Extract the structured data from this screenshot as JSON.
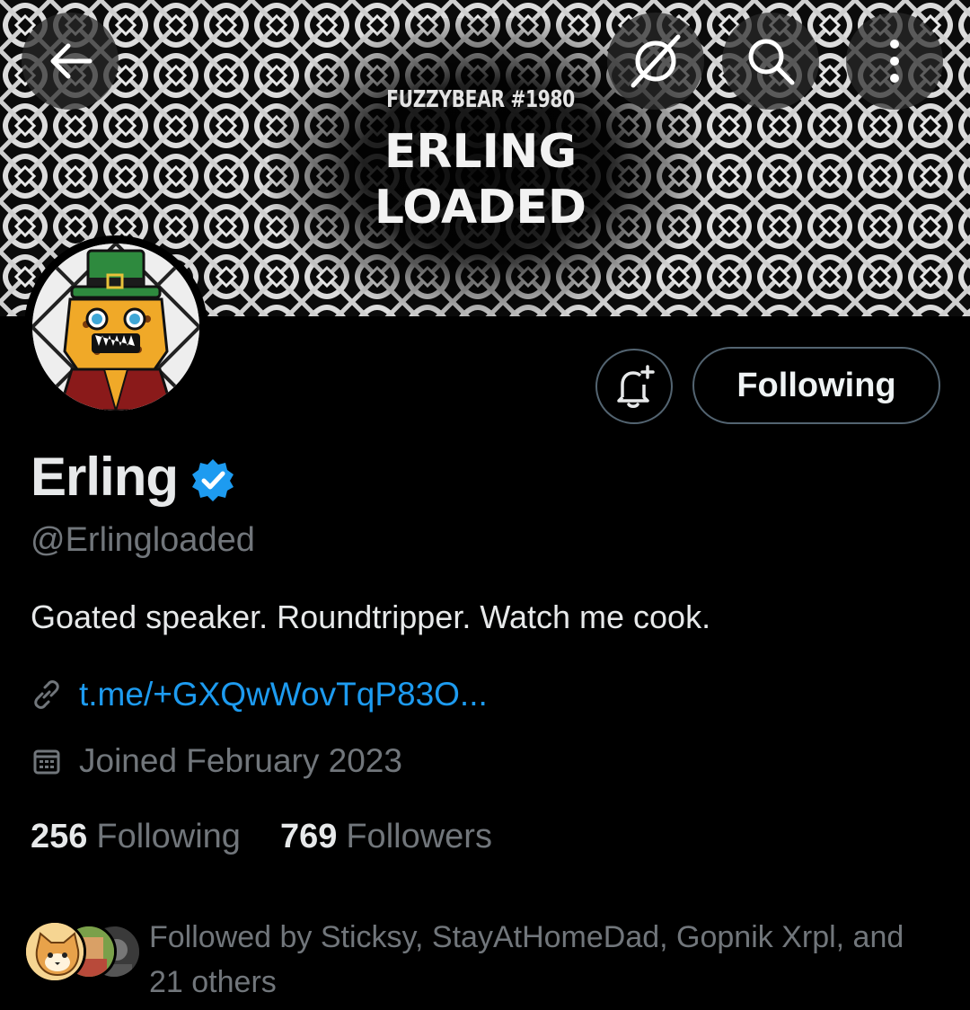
{
  "banner": {
    "subtitle": "FUZZYBEAR #1980",
    "title_line1": "ERLING",
    "title_line2": "LOADED"
  },
  "header_icons": {
    "back": "arrow-left-icon",
    "grok": "grok-icon",
    "search": "search-icon",
    "more": "more-vertical-icon"
  },
  "actions": {
    "notify_icon": "bell-plus-icon",
    "follow_label": "Following"
  },
  "profile": {
    "name": "Erling",
    "verified": true,
    "handle": "@Erlingloaded",
    "bio": "Goated speaker. Roundtripper. Watch me cook.",
    "link": "t.me/+GXQwWovTqP83O...",
    "joined": "Joined February 2023"
  },
  "stats": {
    "following_count": "256",
    "following_label": "Following",
    "followers_count": "769",
    "followers_label": "Followers"
  },
  "followed_by": {
    "text": "Followed by Sticksy, StayAtHomeDad, Gopnik Xrpl, and 21 others"
  },
  "colors": {
    "background": "#000000",
    "primary_text": "#e7e9ea",
    "secondary_text": "#71767b",
    "accent": "#1d9bf0",
    "border": "#536471"
  }
}
